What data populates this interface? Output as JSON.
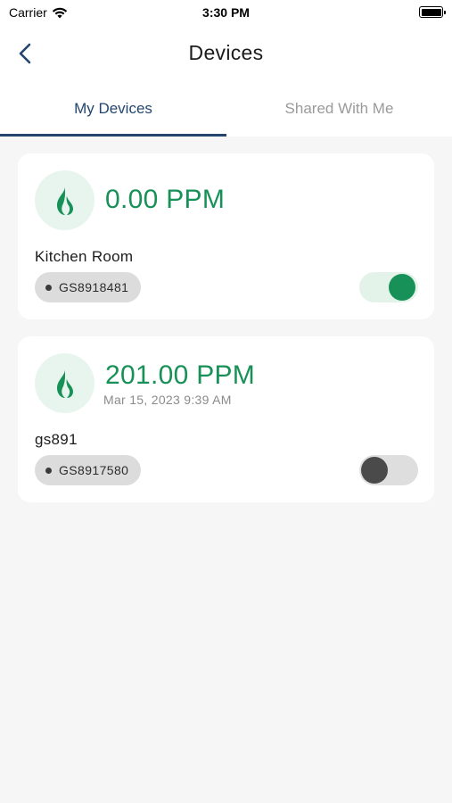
{
  "status_bar": {
    "carrier": "Carrier",
    "time": "3:30 PM"
  },
  "nav": {
    "title": "Devices",
    "back_icon": "chevron-left-icon"
  },
  "tabs": [
    {
      "label": "My Devices",
      "active": true
    },
    {
      "label": "Shared With Me",
      "active": false
    }
  ],
  "devices": [
    {
      "reading": "0.00 PPM",
      "timestamp": "",
      "name": "Kitchen Room",
      "serial": "GS8918481",
      "enabled": true,
      "icon": "flame-icon"
    },
    {
      "reading": "201.00 PPM",
      "timestamp": "Mar 15, 2023 9:39 AM",
      "name": "gs891",
      "serial": "GS8917580",
      "enabled": false,
      "icon": "flame-icon"
    }
  ],
  "colors": {
    "accent": "#179157",
    "tab_active": "#23456e",
    "background": "#f6f6f6"
  }
}
